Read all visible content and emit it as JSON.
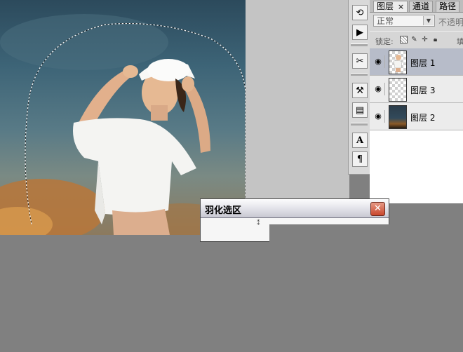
{
  "palette_tabs": [
    "图层",
    "通道",
    "路径"
  ],
  "layers_tab_close": "×",
  "blend_mode": "正常",
  "opacity_label": "不透明",
  "lock_label": "锁定:",
  "fill_label": "填",
  "layers": [
    {
      "name": "图层 1",
      "selected": true
    },
    {
      "name": "图层 3",
      "selected": false
    },
    {
      "name": "图层 2",
      "selected": false
    }
  ],
  "dialog": {
    "title": "羽化选区",
    "close_label": "✕"
  },
  "toolstrip_icons": [
    "history-brush-icon",
    "actions-play-icon",
    "tool-presets-icon",
    "clone-source-icon",
    "layer-comps-icon",
    "character-icon",
    "paragraph-icon"
  ],
  "colors": {
    "selected_layer": "#b7bcc9",
    "dialog_close": "#c9472d",
    "workspace": "#808080"
  }
}
